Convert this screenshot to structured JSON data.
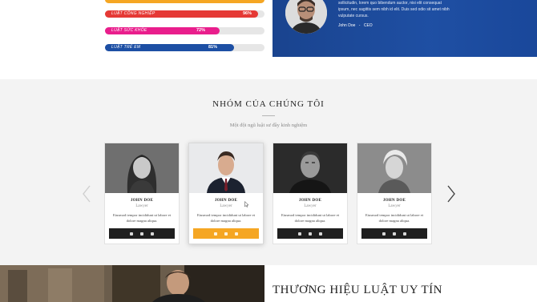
{
  "skills": {
    "items": [
      {
        "label": "LUẬT CÔNG NGHIỆP",
        "percent": "96%",
        "value": 0.96,
        "color": "#e53935"
      },
      {
        "label": "LUẬT SỨC KHỎE",
        "percent": "72%",
        "value": 0.72,
        "color": "#e91e8c"
      },
      {
        "label": "LUẬT TRẺ EM",
        "percent": "81%",
        "value": 0.81,
        "color": "#1d4fa4"
      }
    ]
  },
  "testimonial": {
    "text": "sollicitudin, lorem quo bibendum auctor, nisi elit consequat ipsum, nec sagittis sem nibh id elit. Duis sed odio sit amet nibh vulputate cursus.",
    "author": "John Doe",
    "separator": "-",
    "position": "CEO"
  },
  "team": {
    "title": "NHÓM CỦA CHÚNG TÔI",
    "subtitle": "Một đội ngũ luật sư đầy kinh nghiệm",
    "members": [
      {
        "name": "JOHN DOE",
        "role": "Lawyer",
        "desc": "Eiusmod tempor incididunt ut labore et dolore magna aliqua."
      },
      {
        "name": "JOHN DOE",
        "role": "Lawyer",
        "desc": "Eiusmod tempor incididunt ut labore et dolore magna aliqua."
      },
      {
        "name": "JOHN DOE",
        "role": "Lawyer",
        "desc": "Eiusmod tempor incididunt ut labore et dolore magna aliqua."
      },
      {
        "name": "JOHN DOE",
        "role": "Lawyer",
        "desc": "Eiusmod tempor incididunt ut labore et dolore magna aliqua."
      }
    ],
    "featured_index": 1,
    "social_icons": [
      "facebook-icon",
      "twitter-icon",
      "linkedin-icon"
    ],
    "accent_color": "#f5a623"
  },
  "brand": {
    "title": "THƯƠNG HIỆU LUẬT UY TÍN"
  }
}
